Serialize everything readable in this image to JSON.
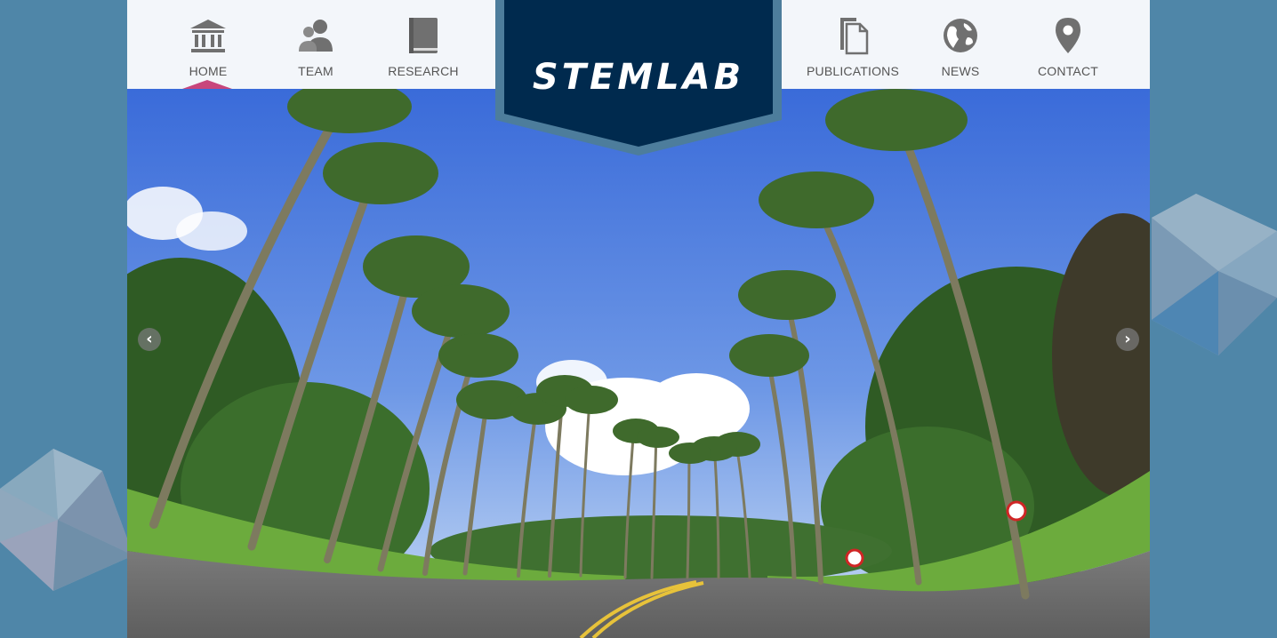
{
  "logo": {
    "text": "STEMLAB"
  },
  "nav": {
    "left": [
      {
        "label": "HOME",
        "icon": "bank-icon",
        "active": true
      },
      {
        "label": "TEAM",
        "icon": "team-icon"
      },
      {
        "label": "RESEARCH",
        "icon": "book-icon"
      }
    ],
    "right": [
      {
        "label": "PUBLICATIONS",
        "icon": "documents-icon"
      },
      {
        "label": "NEWS",
        "icon": "globe-icon"
      },
      {
        "label": "CONTACT",
        "icon": "map-pin-icon"
      }
    ]
  },
  "carousel": {
    "prev_symbol": "‹",
    "next_symbol": "›"
  },
  "colors": {
    "background": "#4f86a8",
    "logo_navy": "#002a4e",
    "logo_border": "#4d7d9c",
    "active_marker": "#c8467c",
    "nav_text": "#555555",
    "icon_gray": "#707070"
  }
}
